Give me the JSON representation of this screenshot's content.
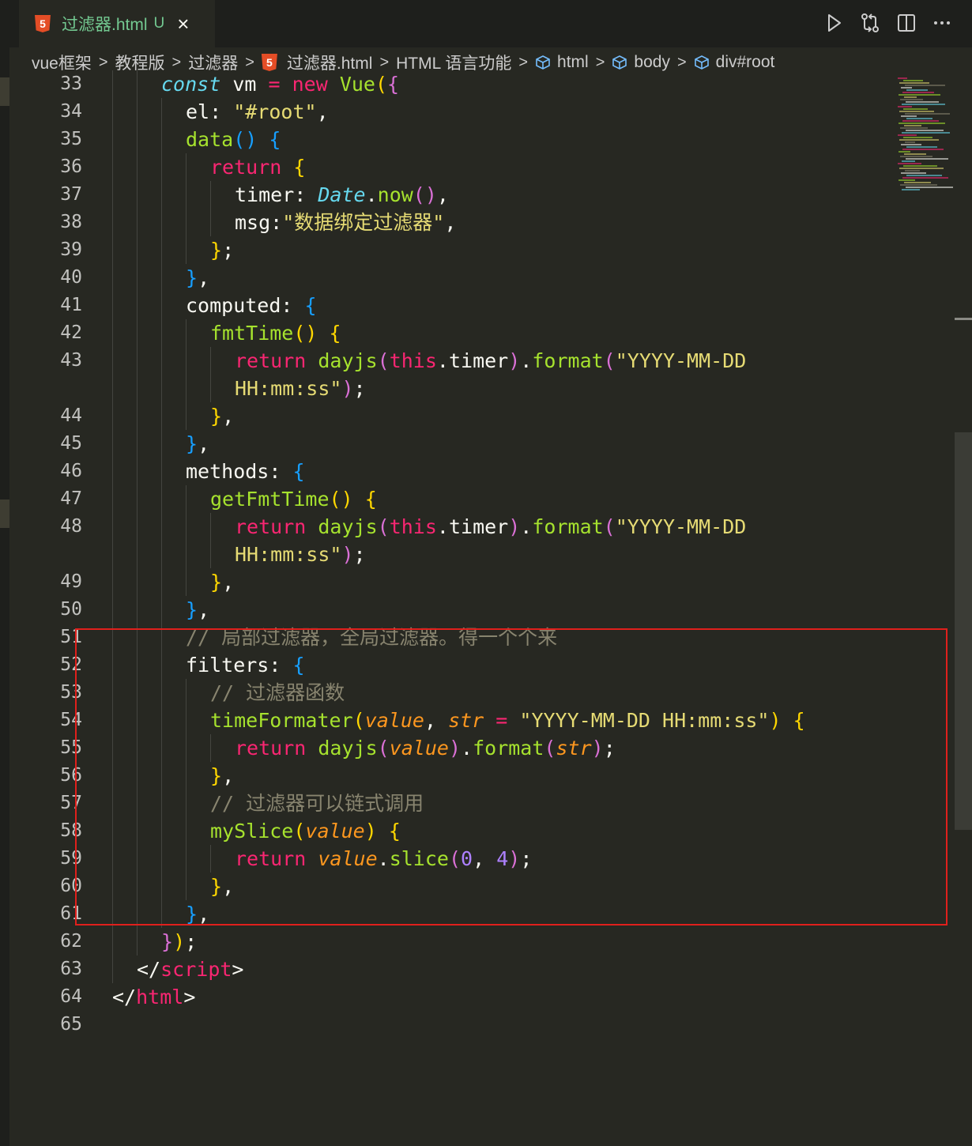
{
  "tab": {
    "file_name": "过滤器.html",
    "status": "U",
    "close_symbol": "×",
    "icon": "html5-icon"
  },
  "toolbar": {
    "run_icon": "play-icon",
    "compare_icon": "git-compare-icon",
    "split_icon": "split-editor-icon",
    "more_icon": "more-icon"
  },
  "breadcrumb": {
    "items": [
      {
        "label": "vue框架",
        "icon": ""
      },
      {
        "label": "教程版",
        "icon": ""
      },
      {
        "label": "过滤器",
        "icon": ""
      },
      {
        "label": "过滤器.html",
        "icon": "html5-icon"
      },
      {
        "label": "HTML 语言功能",
        "icon": ""
      },
      {
        "label": "html",
        "icon": "cube-icon"
      },
      {
        "label": "body",
        "icon": "cube-icon"
      },
      {
        "label": "div#root",
        "icon": "cube-icon"
      }
    ],
    "separator": ">"
  },
  "colors": {
    "background": "#272822",
    "keyword": "#f92672",
    "function": "#a6e22e",
    "string": "#e6db74",
    "comment": "#88846f",
    "number": "#ae81ff",
    "highlight_box": "#e0201c"
  },
  "code_lines": [
    {
      "n": "33",
      "indent": 2,
      "tokens": [
        [
          "const",
          "t"
        ],
        [
          " vm ",
          "w"
        ],
        [
          "=",
          "k"
        ],
        [
          " new ",
          "k"
        ],
        [
          "Vue",
          "f"
        ],
        [
          "(",
          "b1"
        ],
        [
          "{",
          "b2"
        ]
      ]
    },
    {
      "n": "34",
      "indent": 3,
      "tokens": [
        [
          "el: ",
          "w"
        ],
        [
          "\"#root\"",
          "s"
        ],
        [
          ",",
          "w"
        ]
      ]
    },
    {
      "n": "35",
      "indent": 3,
      "tokens": [
        [
          "data",
          "f"
        ],
        [
          "()",
          "b3"
        ],
        [
          " ",
          "w"
        ],
        [
          "{",
          "b3"
        ]
      ]
    },
    {
      "n": "36",
      "indent": 4,
      "tokens": [
        [
          "return",
          "k"
        ],
        [
          " ",
          "w"
        ],
        [
          "{",
          "b1"
        ]
      ]
    },
    {
      "n": "37",
      "indent": 5,
      "tokens": [
        [
          "timer: ",
          "w"
        ],
        [
          "Date",
          "t"
        ],
        [
          ".",
          "w"
        ],
        [
          "now",
          "f"
        ],
        [
          "()",
          "b2"
        ],
        [
          ",",
          "w"
        ]
      ]
    },
    {
      "n": "38",
      "indent": 5,
      "tokens": [
        [
          "msg:",
          "w"
        ],
        [
          "\"数据绑定过滤器\"",
          "s"
        ],
        [
          ",",
          "w"
        ]
      ]
    },
    {
      "n": "39",
      "indent": 4,
      "tokens": [
        [
          "}",
          "b1"
        ],
        [
          ";",
          "w"
        ]
      ]
    },
    {
      "n": "40",
      "indent": 3,
      "tokens": [
        [
          "}",
          "b3"
        ],
        [
          ",",
          "w"
        ]
      ]
    },
    {
      "n": "41",
      "indent": 3,
      "tokens": [
        [
          "computed: ",
          "w"
        ],
        [
          "{",
          "b3"
        ]
      ]
    },
    {
      "n": "42",
      "indent": 4,
      "tokens": [
        [
          "fmtTime",
          "f"
        ],
        [
          "()",
          "b1"
        ],
        [
          " ",
          "w"
        ],
        [
          "{",
          "b1"
        ]
      ]
    },
    {
      "n": "43",
      "indent": 5,
      "tokens": [
        [
          "return",
          "k"
        ],
        [
          " ",
          "w"
        ],
        [
          "dayjs",
          "f"
        ],
        [
          "(",
          "b2"
        ],
        [
          "this",
          "k"
        ],
        [
          ".timer",
          "w"
        ],
        [
          ")",
          "b2"
        ],
        [
          ".",
          "w"
        ],
        [
          "format",
          "f"
        ],
        [
          "(",
          "b2"
        ],
        [
          "\"YYYY-MM-DD",
          "s"
        ]
      ]
    },
    {
      "n": "",
      "indent": 5,
      "tokens": [
        [
          "HH:mm:ss\"",
          "s"
        ],
        [
          ")",
          "b2"
        ],
        [
          ";",
          "w"
        ]
      ]
    },
    {
      "n": "44",
      "indent": 4,
      "tokens": [
        [
          "}",
          "b1"
        ],
        [
          ",",
          "w"
        ]
      ]
    },
    {
      "n": "45",
      "indent": 3,
      "tokens": [
        [
          "}",
          "b3"
        ],
        [
          ",",
          "w"
        ]
      ]
    },
    {
      "n": "46",
      "indent": 3,
      "tokens": [
        [
          "methods: ",
          "w"
        ],
        [
          "{",
          "b3"
        ]
      ]
    },
    {
      "n": "47",
      "indent": 4,
      "tokens": [
        [
          "getFmtTime",
          "f"
        ],
        [
          "()",
          "b1"
        ],
        [
          " ",
          "w"
        ],
        [
          "{",
          "b1"
        ]
      ]
    },
    {
      "n": "48",
      "indent": 5,
      "tokens": [
        [
          "return",
          "k"
        ],
        [
          " ",
          "w"
        ],
        [
          "dayjs",
          "f"
        ],
        [
          "(",
          "b2"
        ],
        [
          "this",
          "k"
        ],
        [
          ".timer",
          "w"
        ],
        [
          ")",
          "b2"
        ],
        [
          ".",
          "w"
        ],
        [
          "format",
          "f"
        ],
        [
          "(",
          "b2"
        ],
        [
          "\"YYYY-MM-DD",
          "s"
        ]
      ]
    },
    {
      "n": "",
      "indent": 5,
      "tokens": [
        [
          "HH:mm:ss\"",
          "s"
        ],
        [
          ")",
          "b2"
        ],
        [
          ";",
          "w"
        ]
      ]
    },
    {
      "n": "49",
      "indent": 4,
      "tokens": [
        [
          "}",
          "b1"
        ],
        [
          ",",
          "w"
        ]
      ]
    },
    {
      "n": "50",
      "indent": 3,
      "tokens": [
        [
          "}",
          "b3"
        ],
        [
          ",",
          "w"
        ]
      ]
    },
    {
      "n": "51",
      "indent": 3,
      "tokens": [
        [
          "// 局部过滤器，全局过滤器。得一个个来",
          "c"
        ]
      ]
    },
    {
      "n": "52",
      "indent": 3,
      "tokens": [
        [
          "filters: ",
          "w"
        ],
        [
          "{",
          "b3"
        ]
      ]
    },
    {
      "n": "53",
      "indent": 4,
      "tokens": [
        [
          "// 过滤器函数",
          "c"
        ]
      ]
    },
    {
      "n": "54",
      "indent": 4,
      "tokens": [
        [
          "timeFormater",
          "f"
        ],
        [
          "(",
          "b1"
        ],
        [
          "value",
          "p"
        ],
        [
          ", ",
          "w"
        ],
        [
          "str",
          "p"
        ],
        [
          " ",
          "w"
        ],
        [
          "=",
          "k"
        ],
        [
          " ",
          "w"
        ],
        [
          "\"YYYY-MM-DD HH:mm:ss\"",
          "s"
        ],
        [
          ")",
          "b1"
        ],
        [
          " ",
          "w"
        ],
        [
          "{",
          "b1"
        ]
      ]
    },
    {
      "n": "55",
      "indent": 5,
      "tokens": [
        [
          "return",
          "k"
        ],
        [
          " ",
          "w"
        ],
        [
          "dayjs",
          "f"
        ],
        [
          "(",
          "b2"
        ],
        [
          "value",
          "p"
        ],
        [
          ")",
          "b2"
        ],
        [
          ".",
          "w"
        ],
        [
          "format",
          "f"
        ],
        [
          "(",
          "b2"
        ],
        [
          "str",
          "p"
        ],
        [
          ")",
          "b2"
        ],
        [
          ";",
          "w"
        ]
      ]
    },
    {
      "n": "56",
      "indent": 4,
      "tokens": [
        [
          "}",
          "b1"
        ],
        [
          ",",
          "w"
        ]
      ]
    },
    {
      "n": "57",
      "indent": 4,
      "tokens": [
        [
          "// 过滤器可以链式调用",
          "c"
        ]
      ]
    },
    {
      "n": "58",
      "indent": 4,
      "tokens": [
        [
          "mySlice",
          "f"
        ],
        [
          "(",
          "b1"
        ],
        [
          "value",
          "p"
        ],
        [
          ")",
          "b1"
        ],
        [
          " ",
          "w"
        ],
        [
          "{",
          "b1"
        ]
      ]
    },
    {
      "n": "59",
      "indent": 5,
      "tokens": [
        [
          "return",
          "k"
        ],
        [
          " ",
          "w"
        ],
        [
          "value",
          "p"
        ],
        [
          ".",
          "w"
        ],
        [
          "slice",
          "f"
        ],
        [
          "(",
          "b2"
        ],
        [
          "0",
          "n"
        ],
        [
          ", ",
          "w"
        ],
        [
          "4",
          "n"
        ],
        [
          ")",
          "b2"
        ],
        [
          ";",
          "w"
        ]
      ]
    },
    {
      "n": "60",
      "indent": 4,
      "tokens": [
        [
          "}",
          "b1"
        ],
        [
          ",",
          "w"
        ]
      ]
    },
    {
      "n": "61",
      "indent": 3,
      "tokens": [
        [
          "}",
          "b3"
        ],
        [
          ",",
          "w"
        ]
      ]
    },
    {
      "n": "62",
      "indent": 2,
      "tokens": [
        [
          "}",
          "b2"
        ],
        [
          ")",
          "b1"
        ],
        [
          ";",
          "w"
        ]
      ]
    },
    {
      "n": "63",
      "indent": 1,
      "tokens": [
        [
          "</",
          "w"
        ],
        [
          "script",
          "k"
        ],
        [
          ">",
          "w"
        ]
      ]
    },
    {
      "n": "64",
      "indent": 0,
      "tokens": [
        [
          "</",
          "w"
        ],
        [
          "html",
          "k"
        ],
        [
          ">",
          "w"
        ]
      ]
    },
    {
      "n": "65",
      "indent": 0,
      "tokens": []
    }
  ]
}
